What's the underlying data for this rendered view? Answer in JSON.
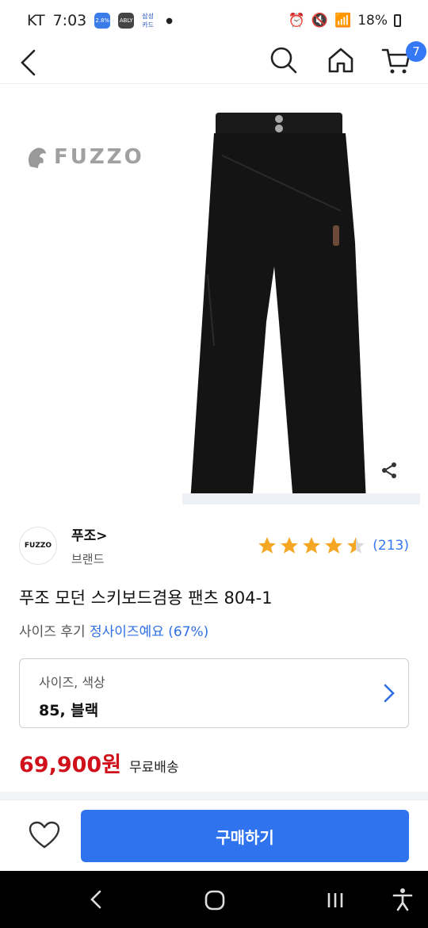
{
  "status": {
    "carrier": "KT",
    "time": "7:03",
    "battery": "18%",
    "badge_1": "2.8%",
    "badge_2": "ABLY",
    "badge_3": "삼성 카드"
  },
  "header": {
    "cart_count": "7"
  },
  "product": {
    "image_brand_text": "FUZZO",
    "brand_logo_text": "FUZZO",
    "brand_name": "푸조>",
    "brand_type": "브랜드",
    "rating": 4.5,
    "rating_count": "(213)",
    "title": "푸조 모던 스키보드겸용 팬츠 804-1",
    "size_review_label": "사이즈 후기",
    "size_review_value": "정사이즈예요 (67%)",
    "option_label": "사이즈, 색상",
    "option_value": "85, 블랙",
    "price": "69,900원",
    "shipping": "무료배송"
  },
  "actions": {
    "buy_label": "구매하기"
  },
  "colors": {
    "accent": "#2f74ee",
    "price": "#d0101b",
    "star": "#f5a623"
  },
  "icons": [
    "back-arrow-icon",
    "search-icon",
    "home-icon",
    "cart-icon",
    "share-icon",
    "star-icon",
    "chevron-right-icon",
    "heart-icon",
    "nav-back-icon",
    "nav-home-icon",
    "nav-recents-icon",
    "accessibility-icon"
  ]
}
